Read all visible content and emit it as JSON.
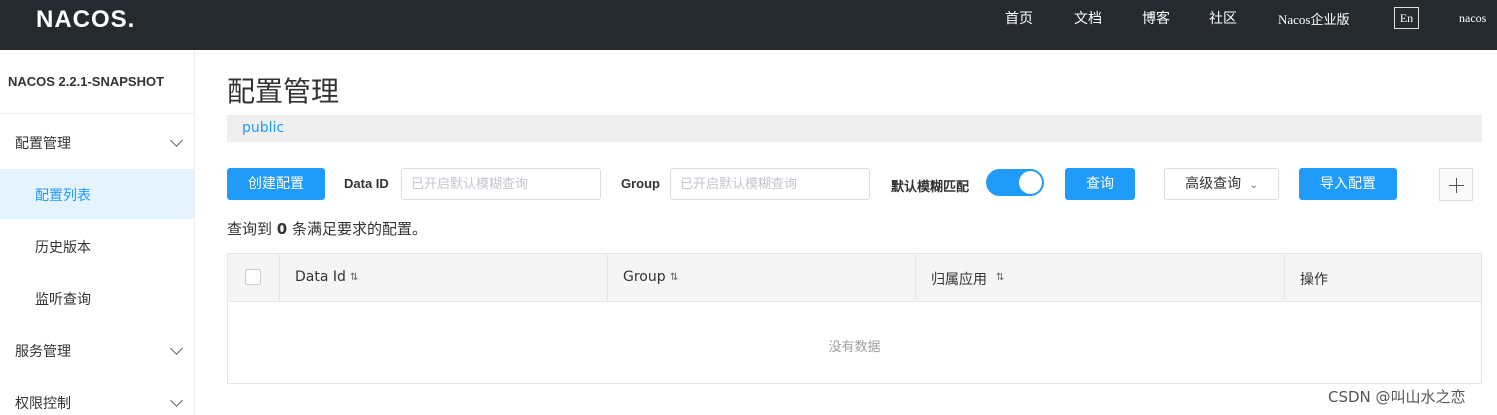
{
  "header": {
    "logo": "NACOS.",
    "nav": [
      "首页",
      "文档",
      "博客",
      "社区",
      "Nacos企业版"
    ],
    "lang": "En",
    "user": "nacos"
  },
  "sidebar": {
    "brand": "NACOS 2.2.1-SNAPSHOT",
    "items": [
      {
        "label": "配置管理",
        "type": "group",
        "icon": "chevron-down-icon"
      },
      {
        "label": "配置列表",
        "type": "sub",
        "active": true
      },
      {
        "label": "历史版本",
        "type": "sub"
      },
      {
        "label": "监听查询",
        "type": "sub"
      },
      {
        "label": "服务管理",
        "type": "group",
        "icon": "chevron-down-icon"
      },
      {
        "label": "权限控制",
        "type": "group",
        "icon": "chevron-down-icon"
      }
    ]
  },
  "main": {
    "title": "配置管理",
    "namespace": "public",
    "toolbar": {
      "create_label": "创建配置",
      "dataid_label": "Data ID",
      "dataid_placeholder": "已开启默认模糊查询",
      "group_label": "Group",
      "group_placeholder": "已开启默认模糊查询",
      "fuzzy_label": "默认模糊匹配",
      "fuzzy_on": true,
      "query_label": "查询",
      "advanced_label": "高级查询",
      "import_label": "导入配置",
      "plus_icon": "plus-icon"
    },
    "result": {
      "prefix": "查询到",
      "count": "0",
      "suffix": "条满足要求的配置。"
    },
    "table": {
      "columns": [
        "Data Id",
        "Group",
        "归属应用",
        "操作"
      ],
      "sort_icon": "⇅",
      "empty_text": "没有数据"
    }
  },
  "watermark": "CSDN @叫山水之恋",
  "colors": {
    "topbar": "#252a2f",
    "primary": "#209bfa",
    "active_bg": "#e4f3fe"
  }
}
